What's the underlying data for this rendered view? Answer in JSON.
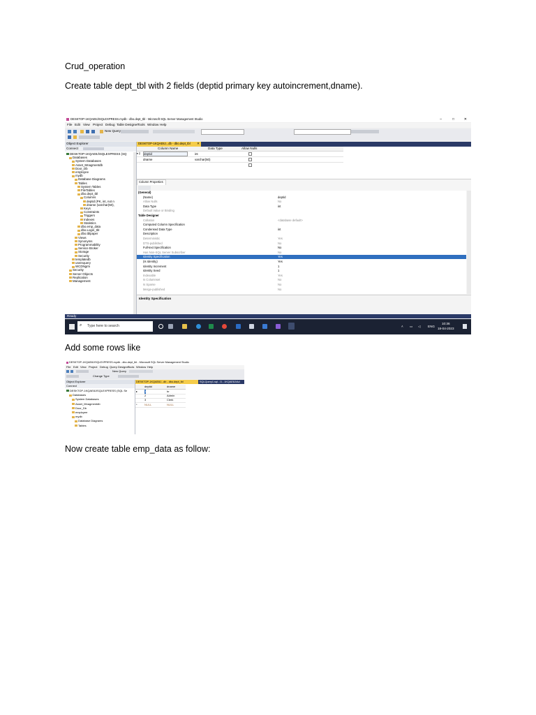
{
  "doc": {
    "heading": "Crud_operation",
    "step1": "Create table dept_tbl with 2 fields (deptid primary key autoincrement,dname).",
    "step2": "Add some rows like",
    "step3": "Now  create table emp_data as follow:"
  },
  "shot1": {
    "title": "DESKTOP-1KQAE8J\\SQLEXPRESS.mydb - dbo.dept_tbl - Microsoft SQL Server Management Studio",
    "menu": [
      "File",
      "Edit",
      "View",
      "Project",
      "Debug",
      "Table Designer",
      "Tools",
      "Window",
      "Help"
    ],
    "new_query": "New Query",
    "object_explorer": "Object Explorer",
    "connect": "Connect",
    "tree": [
      "DESKTOP-1KQAE8J\\SQLEXPRESS (SQ",
      "Databases",
      "System Databases",
      "Asset_Mnagmentdb",
      "Door_Db",
      "employee",
      "mydb",
      "Database Diagrams",
      "Tables",
      "System Tables",
      "FileTables",
      "dbo.dept_tbl",
      "Columns",
      "deptid (PK, int, not n",
      "dname (varchar(50),",
      "Keys",
      "Constraints",
      "Triggers",
      "Indexes",
      "Statistics",
      "dbo.emp_data",
      "dbo.Login_tbl",
      "dbo.tblpaper",
      "Views",
      "Synonyms",
      "Programmability",
      "Service Broker",
      "Storage",
      "Security",
      "templatedb",
      "userequery",
      "WCDNgrm",
      "Security",
      "Server Objects",
      "Replication",
      "Management"
    ],
    "tab": "DESKTOP-1KQAE8J...db - dbo.dept_tbl",
    "grid_headers": [
      "Column Name",
      "Data Type",
      "Allow Nulls"
    ],
    "grid_rows": [
      {
        "name": "deptid",
        "type": "int"
      },
      {
        "name": "dname",
        "type": "varchar(50)"
      }
    ],
    "column_properties": "Column Properties",
    "props": [
      {
        "name": "(General)",
        "value": "",
        "kind": "section"
      },
      {
        "name": "(Name)",
        "value": "deptid",
        "kind": "row"
      },
      {
        "name": "Allow Nulls",
        "value": "No",
        "kind": "dim"
      },
      {
        "name": "Data Type",
        "value": "int",
        "kind": "row"
      },
      {
        "name": "Default Value or Binding",
        "value": "",
        "kind": "dim"
      },
      {
        "name": "Table Designer",
        "value": "",
        "kind": "section"
      },
      {
        "name": "Collation",
        "value": "<database default>",
        "kind": "dim"
      },
      {
        "name": "Computed Column Specification",
        "value": "",
        "kind": "row"
      },
      {
        "name": "Condensed Data Type",
        "value": "int",
        "kind": "row"
      },
      {
        "name": "Description",
        "value": "",
        "kind": "row"
      },
      {
        "name": "Deterministic",
        "value": "Yes",
        "kind": "dim"
      },
      {
        "name": "DTS-published",
        "value": "No",
        "kind": "dim"
      },
      {
        "name": "Full-text Specification",
        "value": "No",
        "kind": "row"
      },
      {
        "name": "Has Non-SQL Server Subscriber",
        "value": "No",
        "kind": "dim"
      },
      {
        "name": "Identity Specification",
        "value": "Yes",
        "kind": "selected"
      },
      {
        "name": "(Is Identity)",
        "value": "Yes",
        "kind": "row"
      },
      {
        "name": "Identity Increment",
        "value": "1",
        "kind": "row"
      },
      {
        "name": "Identity Seed",
        "value": "1",
        "kind": "row"
      },
      {
        "name": "Indexable",
        "value": "Yes",
        "kind": "dim"
      },
      {
        "name": "Is Columnset",
        "value": "No",
        "kind": "dim"
      },
      {
        "name": "Is Sparse",
        "value": "No",
        "kind": "dim"
      },
      {
        "name": "Merge-published",
        "value": "No",
        "kind": "dim"
      }
    ],
    "prop_desc": "Identity Specification",
    "status": "Ready",
    "search": "Type here to search",
    "clock_time": "10:36",
    "clock_date": "18-04-2023",
    "lang": "ENG"
  },
  "shot2": {
    "title": "DESKTOP-1KQAE8J\\SQLEXPRESS.mydb - dbo.dept_tbl - Microsoft SQL Server Management Studio",
    "menu": [
      "File",
      "Edit",
      "View",
      "Project",
      "Debug",
      "Query Designer",
      "Tools",
      "Window",
      "Help"
    ],
    "new_query": "New Query",
    "change_type": "Change Type",
    "object_explorer": "Object Explorer",
    "connect": "Connect",
    "tree": [
      "DESKTOP-1KQAE8J\\SQLEXPRESS (SQL Se",
      "Databases",
      "System Databases",
      "Asset_Mnagmentdb",
      "Door_Db",
      "employee",
      "mydb",
      "Database Diagrams",
      "Tables"
    ],
    "tab1": "DESKTOP-1KQAE8J...db - dbo.dept_tbl",
    "tab2": "SQLQuery1.sql - D...1KQAE8J\\Ad",
    "headers": [
      "deptid",
      "dname"
    ],
    "rows": [
      {
        "id": "1",
        "name": "hr"
      },
      {
        "id": "2",
        "name": "Admin"
      },
      {
        "id": "3",
        "name": "Clerk"
      },
      {
        "id": "NULL",
        "name": "NULL"
      }
    ]
  }
}
